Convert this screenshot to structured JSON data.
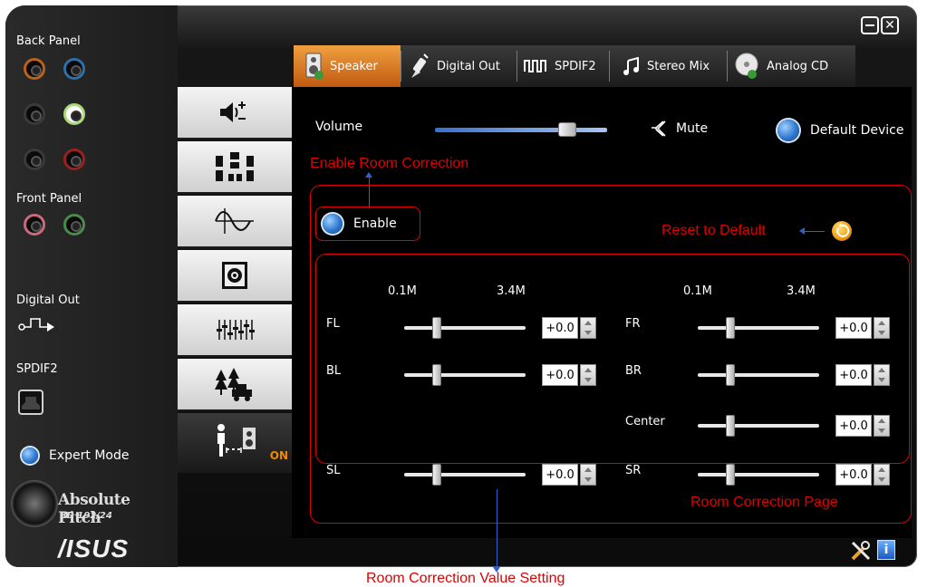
{
  "left_panel": {
    "back_panel_label": "Back Panel",
    "front_panel_label": "Front Panel",
    "digital_out_label": "Digital Out",
    "spdif2_label": "SPDIF2",
    "expert_mode_label": "Expert Mode",
    "brand_title": "Absolute Pitch",
    "brand_subtitle": "BD 192/24",
    "asus_logo_text": "/ISUS"
  },
  "window_controls": [
    "minimize-icon",
    "close-icon"
  ],
  "tabs": [
    {
      "label": "Speaker",
      "icon": "speaker-icon",
      "active": true
    },
    {
      "label": "Digital Out",
      "icon": "plug-icon",
      "active": false
    },
    {
      "label": "SPDIF2",
      "icon": "pulse-icon",
      "active": false
    },
    {
      "label": "Stereo Mix",
      "icon": "music-note-icon",
      "active": false
    },
    {
      "label": "Analog CD",
      "icon": "cd-icon",
      "active": false
    }
  ],
  "sidebar": {
    "items": [
      "volume-icon",
      "speaker-array-icon",
      "waveform-icon",
      "subwoofer-icon",
      "equalizer-icon",
      "environment-icon",
      "room-correction-icon"
    ],
    "active_badge": "ON"
  },
  "volume": {
    "label": "Volume",
    "level": 0.8,
    "mute_label": "Mute",
    "default_device_label": "Default Device"
  },
  "room_correction": {
    "enable_label": "Enable",
    "scale_min": "0.1M",
    "scale_max": "3.4M",
    "channels": [
      {
        "name": "FL",
        "value": "+0.0",
        "position": 0.25
      },
      {
        "name": "BL",
        "value": "+0.0",
        "position": 0.25
      },
      {
        "name": "SL",
        "value": "+0.0",
        "position": 0.25
      },
      {
        "name": "FR",
        "value": "+0.0",
        "position": 0.25
      },
      {
        "name": "BR",
        "value": "+0.0",
        "position": 0.25
      },
      {
        "name": "Center",
        "value": "+0.0",
        "position": 0.25
      },
      {
        "name": "SR",
        "value": "+0.0",
        "position": 0.25
      }
    ]
  },
  "annotations": {
    "enable_room_correction": "Enable Room Correction",
    "reset_to_default": "Reset to Default",
    "room_correction_page": "Room Correction Page",
    "room_correction_value_setting": "Room Correction Value Setting"
  },
  "colors": {
    "accent_orange": "#e07820",
    "annotation_red": "#e00000",
    "annotation_arrow": "#2f5fd0"
  }
}
